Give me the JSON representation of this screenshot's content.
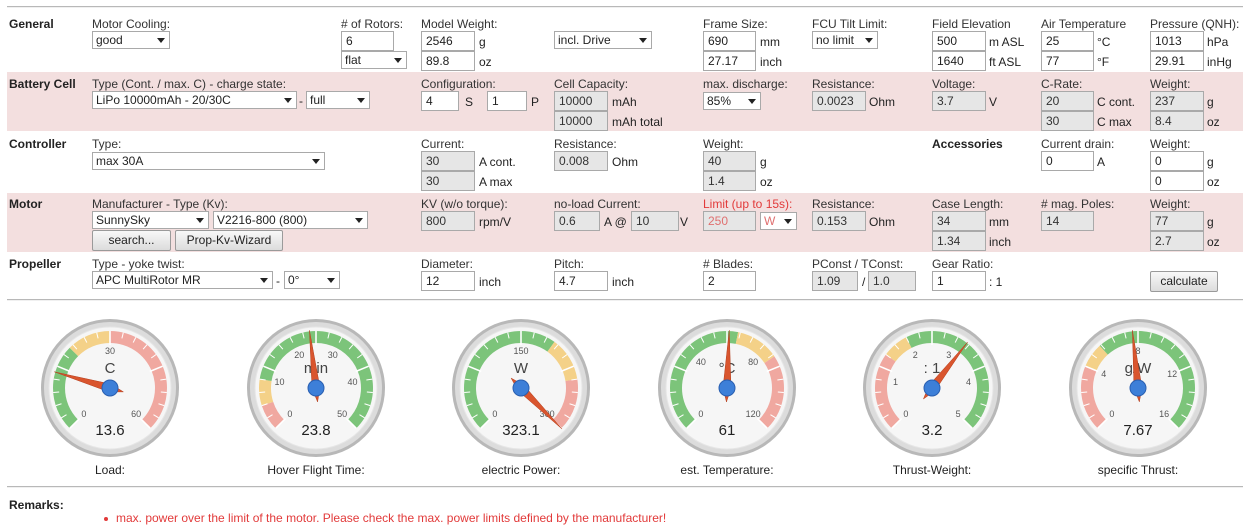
{
  "general": {
    "title": "General",
    "motor_cooling": {
      "label": "Motor Cooling:",
      "value": "good"
    },
    "rotors": {
      "label": "# of Rotors:",
      "value": "6",
      "layout": "flat"
    },
    "model_weight": {
      "label": "Model Weight:",
      "value_g": "2546",
      "unit_g": "g",
      "value_oz": "89.8",
      "unit_oz": "oz"
    },
    "drive": "incl. Drive",
    "frame_size": {
      "label": "Frame Size:",
      "value_mm": "690",
      "unit_mm": "mm",
      "value_inch": "27.17",
      "unit_inch": "inch"
    },
    "fcu_tilt": {
      "label": "FCU Tilt Limit:",
      "value": "no limit"
    },
    "field_elevation": {
      "label": "Field Elevation",
      "value_m": "500",
      "unit_m": "m ASL",
      "value_ft": "1640",
      "unit_ft": "ft ASL"
    },
    "air_temp": {
      "label": "Air Temperature",
      "value_c": "25",
      "unit_c": "°C",
      "value_f": "77",
      "unit_f": "°F"
    },
    "pressure": {
      "label": "Pressure (QNH):",
      "value_hpa": "1013",
      "unit_hpa": "hPa",
      "value_inhg": "29.91",
      "unit_inhg": "inHg"
    }
  },
  "battery": {
    "title": "Battery Cell",
    "type": {
      "label": "Type (Cont. / max. C) - charge state:",
      "value": "LiPo 10000mAh - 20/30C",
      "sep": "-",
      "charge": "full"
    },
    "configuration": {
      "label": "Configuration:",
      "s": "4",
      "s_unit": "S",
      "p": "1",
      "p_unit": "P"
    },
    "capacity": {
      "label": "Cell Capacity:",
      "value": "10000",
      "unit": "mAh",
      "total": "10000",
      "total_unit": "mAh total"
    },
    "max_discharge": {
      "label": "max. discharge:",
      "value": "85%"
    },
    "resistance": {
      "label": "Resistance:",
      "value": "0.0023",
      "unit": "Ohm"
    },
    "voltage": {
      "label": "Voltage:",
      "value": "3.7",
      "unit": "V"
    },
    "c_rate": {
      "label": "C-Rate:",
      "cont": "20",
      "cont_unit": "C cont.",
      "max": "30",
      "max_unit": "C max"
    },
    "weight": {
      "label": "Weight:",
      "g": "237",
      "g_unit": "g",
      "oz": "8.4",
      "oz_unit": "oz"
    }
  },
  "controller": {
    "title": "Controller",
    "type": {
      "label": "Type:",
      "value": "max 30A"
    },
    "current": {
      "label": "Current:",
      "cont": "30",
      "cont_unit": "A cont.",
      "max": "30",
      "max_unit": "A max"
    },
    "resistance": {
      "label": "Resistance:",
      "value": "0.008",
      "unit": "Ohm"
    },
    "weight": {
      "label": "Weight:",
      "g": "40",
      "g_unit": "g",
      "oz": "1.4",
      "oz_unit": "oz"
    }
  },
  "accessories": {
    "title": "Accessories",
    "current_drain": {
      "label": "Current drain:",
      "value": "0",
      "unit": "A"
    },
    "weight": {
      "label": "Weight:",
      "g": "0",
      "g_unit": "g",
      "oz": "0",
      "oz_unit": "oz"
    }
  },
  "motor": {
    "title": "Motor",
    "manufacturer": {
      "label": "Manufacturer - Type (Kv):",
      "value": "SunnySky",
      "type": "V2216-800 (800)"
    },
    "search_button": "search...",
    "wizard_button": "Prop-Kv-Wizard",
    "kv": {
      "label": "KV (w/o torque):",
      "value": "800",
      "unit": "rpm/V"
    },
    "noload": {
      "label": "no-load Current:",
      "value": "0.6",
      "unit": "A @",
      "volt": "10",
      "volt_unit": "V"
    },
    "limit": {
      "label": "Limit (up to 15s):",
      "value": "250",
      "unit": "W"
    },
    "resistance": {
      "label": "Resistance:",
      "value": "0.153",
      "unit": "Ohm"
    },
    "case_length": {
      "label": "Case Length:",
      "mm": "34",
      "mm_unit": "mm",
      "inch": "1.34",
      "inch_unit": "inch"
    },
    "poles": {
      "label": "# mag. Poles:",
      "value": "14"
    },
    "weight": {
      "label": "Weight:",
      "g": "77",
      "g_unit": "g",
      "oz": "2.7",
      "oz_unit": "oz"
    }
  },
  "propeller": {
    "title": "Propeller",
    "type": {
      "label": "Type - yoke twist:",
      "value": "APC MultiRotor MR",
      "sep": "-",
      "twist": "0°"
    },
    "diameter": {
      "label": "Diameter:",
      "value": "12",
      "unit": "inch"
    },
    "pitch": {
      "label": "Pitch:",
      "value": "4.7",
      "unit": "inch"
    },
    "blades": {
      "label": "# Blades:",
      "value": "2"
    },
    "pconst": {
      "label": "PConst / TConst:",
      "p": "1.09",
      "sep": "/",
      "t": "1.0"
    },
    "gear": {
      "label": "Gear Ratio:",
      "value": "1",
      "suffix": ": 1"
    },
    "calculate_button": "calculate"
  },
  "gauges": [
    {
      "label": "Load:",
      "unit": "C",
      "value": "13.6",
      "min": 0,
      "max": 60,
      "ticks": [
        "0",
        "30",
        "60"
      ],
      "needle": 13.6,
      "zones": [
        {
          "from": 0,
          "to": 20,
          "color": "#7cc47a"
        },
        {
          "from": 20,
          "to": 30,
          "color": "#f4d188"
        },
        {
          "from": 30,
          "to": 60,
          "color": "#f0a8a0"
        }
      ]
    },
    {
      "label": "Hover Flight Time:",
      "unit": "min",
      "value": "23.8",
      "min": 0,
      "max": 50,
      "ticks": [
        "0",
        "10",
        "20",
        "30",
        "40",
        "50"
      ],
      "needle": 23.8,
      "zones": [
        {
          "from": 0,
          "to": 5,
          "color": "#f0a8a0"
        },
        {
          "from": 5,
          "to": 10,
          "color": "#f4d188"
        },
        {
          "from": 10,
          "to": 50,
          "color": "#7cc47a"
        }
      ]
    },
    {
      "label": "electric Power:",
      "unit": "W",
      "value": "323.1",
      "min": 0,
      "max": 300,
      "ticks": [
        "0",
        "150",
        "300"
      ],
      "needle": 323.1,
      "zones": [
        {
          "from": 0,
          "to": 190,
          "color": "#7cc47a"
        },
        {
          "from": 190,
          "to": 240,
          "color": "#f4d188"
        },
        {
          "from": 240,
          "to": 300,
          "color": "#f0a8a0"
        }
      ]
    },
    {
      "label": "est. Temperature:",
      "unit": "°C",
      "value": "61",
      "min": 0,
      "max": 120,
      "ticks": [
        "0",
        "40",
        "80",
        "120"
      ],
      "needle": 61,
      "zones": [
        {
          "from": 0,
          "to": 65,
          "color": "#7cc47a"
        },
        {
          "from": 65,
          "to": 85,
          "color": "#f4d188"
        },
        {
          "from": 85,
          "to": 120,
          "color": "#f0a8a0"
        }
      ]
    },
    {
      "label": "Thrust-Weight:",
      "unit": ": 1",
      "value": "3.2",
      "min": 0,
      "max": 5,
      "ticks": [
        "0",
        "1",
        "2",
        "3",
        "4",
        "5"
      ],
      "needle": 3.2,
      "zones": [
        {
          "from": 0,
          "to": 1.5,
          "color": "#f0a8a0"
        },
        {
          "from": 1.5,
          "to": 2,
          "color": "#f4d188"
        },
        {
          "from": 2,
          "to": 5,
          "color": "#7cc47a"
        }
      ]
    },
    {
      "label": "specific Thrust:",
      "unit": "g/W",
      "value": "7.67",
      "min": 0,
      "max": 16,
      "ticks": [
        "0",
        "4",
        "8",
        "12",
        "16"
      ],
      "needle": 7.67,
      "zones": [
        {
          "from": 0,
          "to": 4,
          "color": "#f0a8a0"
        },
        {
          "from": 4,
          "to": 5.5,
          "color": "#f4d188"
        },
        {
          "from": 5.5,
          "to": 16,
          "color": "#7cc47a"
        }
      ]
    }
  ],
  "remarks": {
    "title": "Remarks:",
    "items": [
      "max. power over the limit of the motor. Please check the max. power limits defined by the manufacturer!"
    ]
  }
}
